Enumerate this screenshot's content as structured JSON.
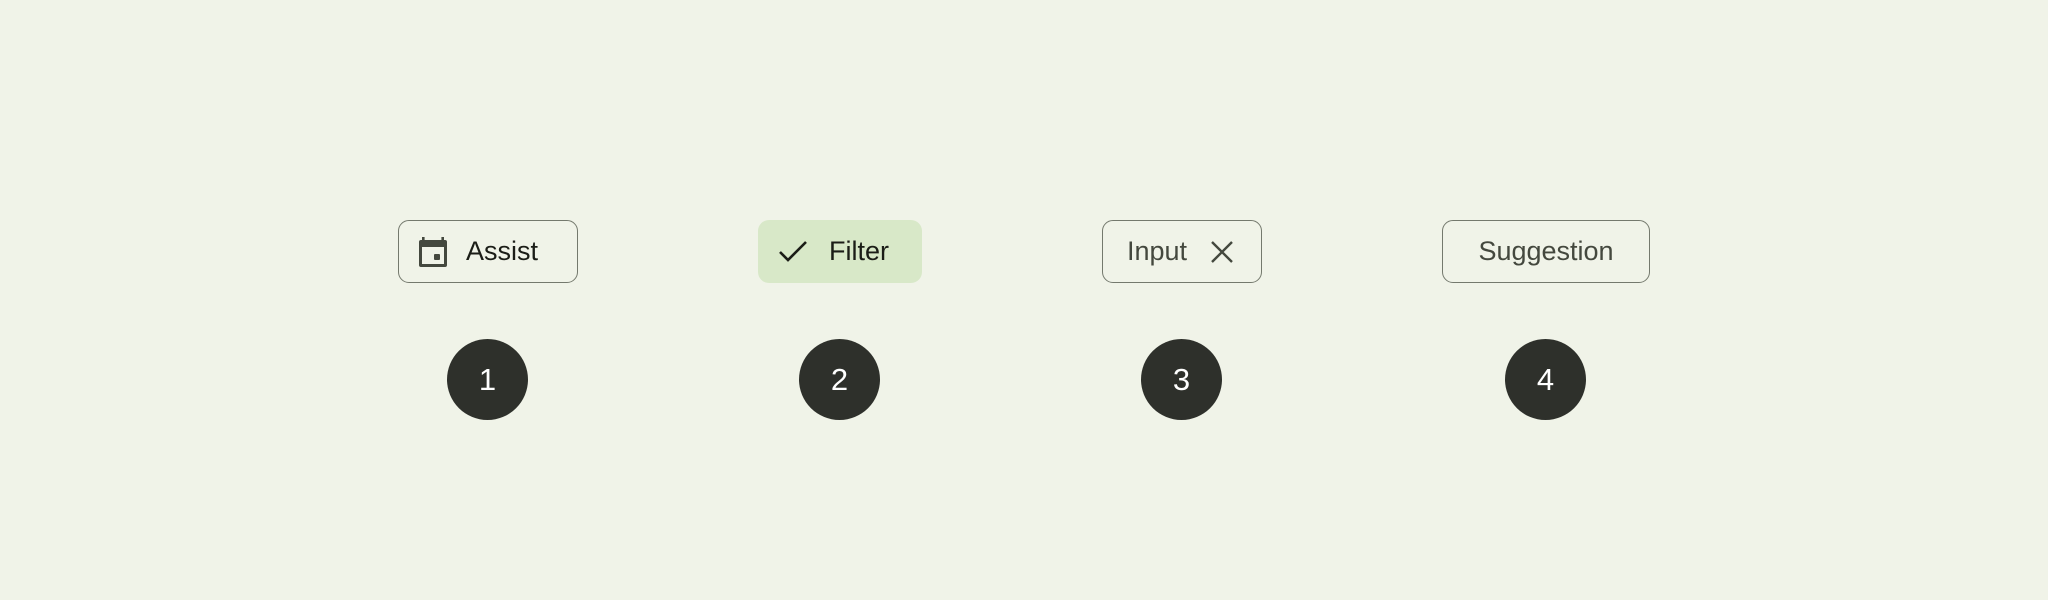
{
  "colors": {
    "background": "#f0f3e8",
    "chip_outline": "#74796d",
    "filter_selected_bg": "#d8e8c8",
    "badge_bg": "#2e302b",
    "badge_text": "#ffffff"
  },
  "chips": {
    "assist": {
      "label": "Assist",
      "icon": "calendar-icon",
      "style": "outlined"
    },
    "filter": {
      "label": "Filter",
      "icon": "check-icon",
      "style": "filled",
      "selected": true
    },
    "input": {
      "label": "Input",
      "icon": "close-icon",
      "style": "outlined"
    },
    "suggestion": {
      "label": "Suggestion",
      "style": "outlined"
    }
  },
  "badges": [
    "1",
    "2",
    "3",
    "4"
  ]
}
